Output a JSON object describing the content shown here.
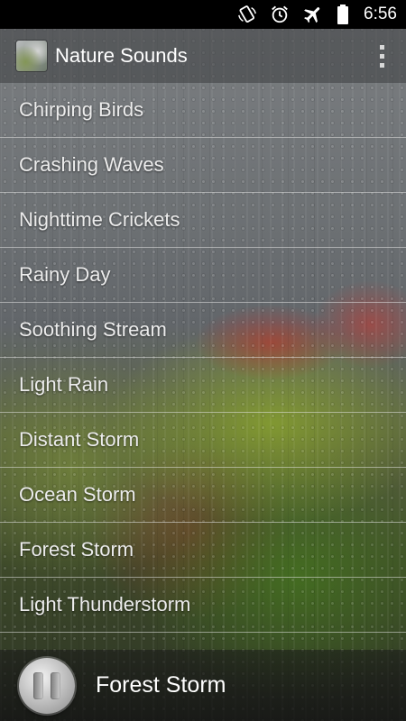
{
  "status_bar": {
    "time": "6:56",
    "icons": [
      "screen-rotation-icon",
      "alarm-icon",
      "airplane-mode-icon",
      "battery-icon"
    ]
  },
  "action_bar": {
    "app_name": "Nature Sounds",
    "icon": "app-logo-icon",
    "overflow_icon": "more-vert-icon"
  },
  "sounds": [
    {
      "label": "Chirping Birds"
    },
    {
      "label": "Crashing Waves"
    },
    {
      "label": "Nighttime Crickets"
    },
    {
      "label": "Rainy Day"
    },
    {
      "label": "Soothing Stream"
    },
    {
      "label": "Light Rain"
    },
    {
      "label": "Distant Storm"
    },
    {
      "label": "Ocean Storm"
    },
    {
      "label": "Forest Storm"
    },
    {
      "label": "Light Thunderstorm"
    }
  ],
  "player": {
    "now_playing": "Forest Storm",
    "button_icon": "pause-icon"
  }
}
